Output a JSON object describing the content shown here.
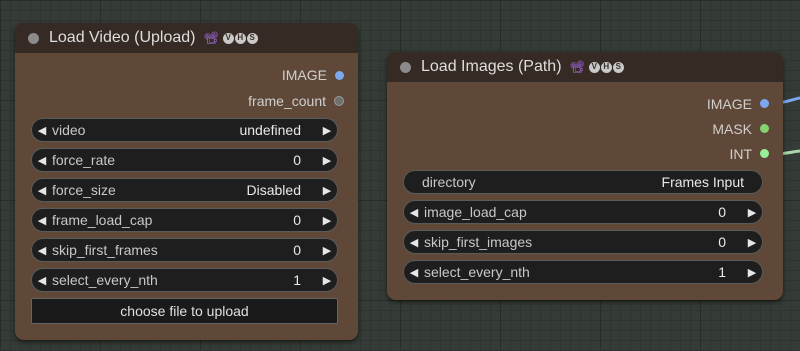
{
  "colors": {
    "image_slot": "#7da7f0",
    "mask_slot": "#84d36c",
    "int_slot": "#99ee99",
    "frame_count_slot": "#777777",
    "node_body": "#5f4838",
    "node_title": "#352a24"
  },
  "icons": {
    "arrow_left": "◀",
    "arrow_right": "▶",
    "camera": "📽",
    "badge_v": "V",
    "badge_h": "H",
    "badge_s": "S"
  },
  "load_video": {
    "title": "Load Video (Upload)",
    "outputs": [
      {
        "label": "IMAGE"
      },
      {
        "label": "frame_count"
      }
    ],
    "widgets": {
      "video": {
        "label": "video",
        "value": "undefined"
      },
      "force_rate": {
        "label": "force_rate",
        "value": "0"
      },
      "force_size": {
        "label": "force_size",
        "value": "Disabled"
      },
      "frame_load_cap": {
        "label": "frame_load_cap",
        "value": "0"
      },
      "skip_first_frames": {
        "label": "skip_first_frames",
        "value": "0"
      },
      "select_every_nth": {
        "label": "select_every_nth",
        "value": "1"
      }
    },
    "upload_button": "choose file to upload"
  },
  "load_images": {
    "title": "Load Images (Path)",
    "outputs": [
      {
        "label": "IMAGE"
      },
      {
        "label": "MASK"
      },
      {
        "label": "INT"
      }
    ],
    "widgets": {
      "directory": {
        "label": "directory",
        "value": "Frames Input"
      },
      "image_load_cap": {
        "label": "image_load_cap",
        "value": "0"
      },
      "skip_first_images": {
        "label": "skip_first_images",
        "value": "0"
      },
      "select_every_nth": {
        "label": "select_every_nth",
        "value": "1"
      }
    }
  }
}
